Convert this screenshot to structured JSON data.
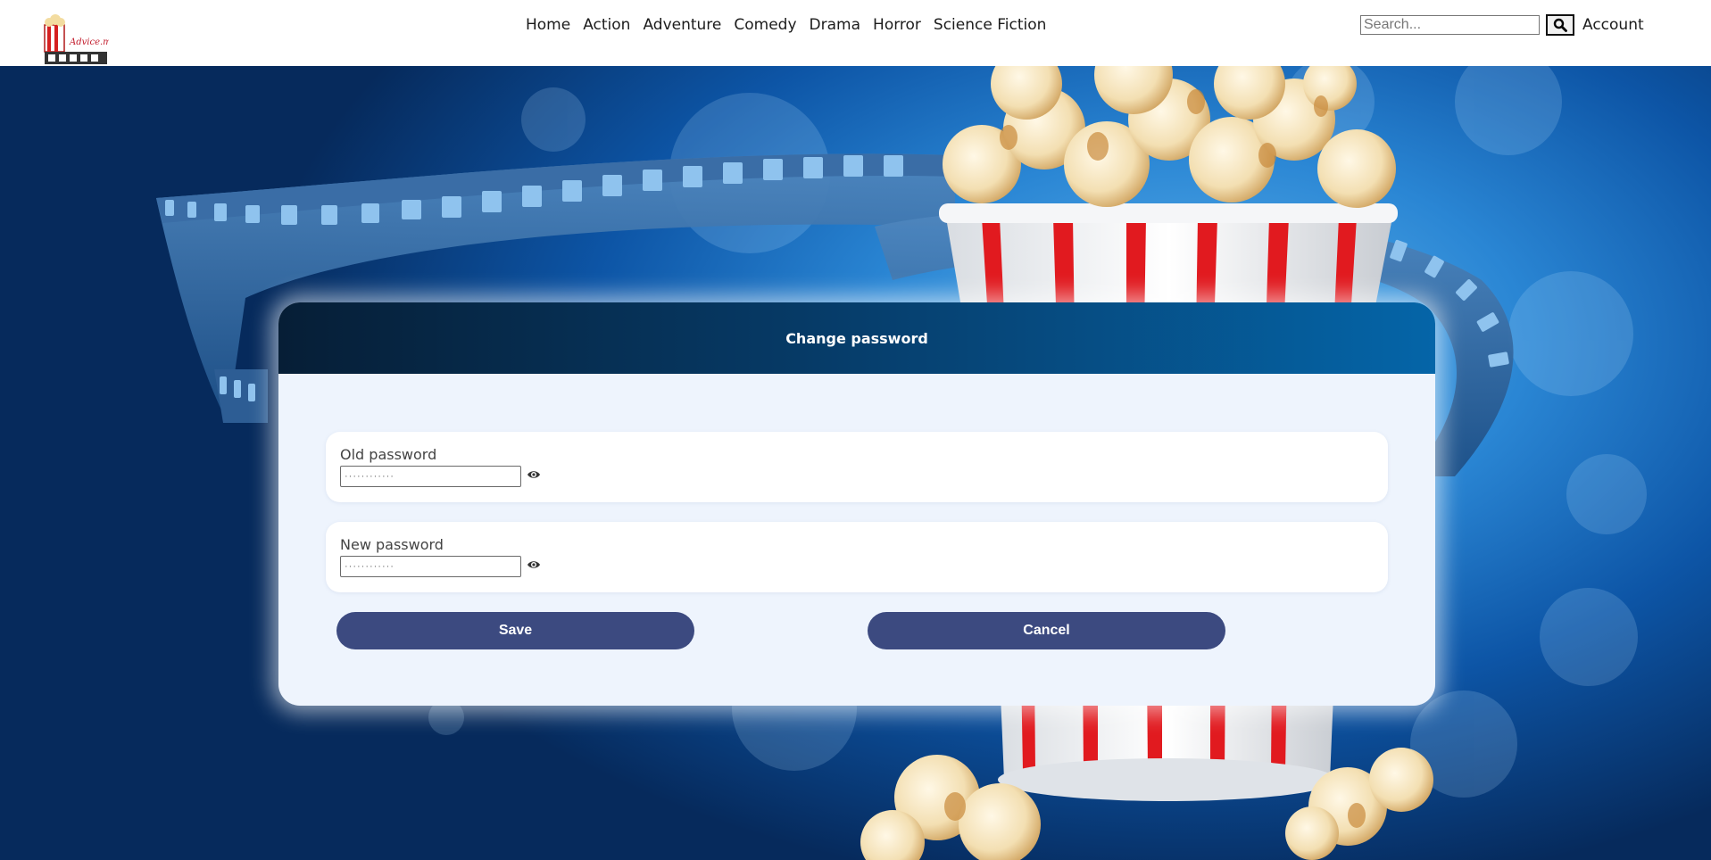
{
  "header": {
    "logo_text": "Advice.me",
    "nav": [
      "Home",
      "Action",
      "Adventure",
      "Comedy",
      "Drama",
      "Horror",
      "Science Fiction"
    ],
    "search": {
      "placeholder": "Search..."
    },
    "account_label": "Account"
  },
  "form": {
    "title": "Change password",
    "old_password": {
      "label": "Old password",
      "value": "············"
    },
    "new_password": {
      "label": "New password",
      "value": "············"
    },
    "save_label": "Save",
    "cancel_label": "Cancel"
  },
  "icons": {
    "logo": "popcorn-film-logo",
    "search": "search-icon",
    "toggle_visibility": "eye-icon"
  },
  "colors": {
    "header_bg": "#ffffff",
    "card_bg": "#eef4fd",
    "card_header_start": "#061e36",
    "card_header_end": "#0565a8",
    "button_bg": "#3c4a80",
    "background_blue": "#0a3f7c",
    "popcorn_stripe": "#e11a1f"
  }
}
